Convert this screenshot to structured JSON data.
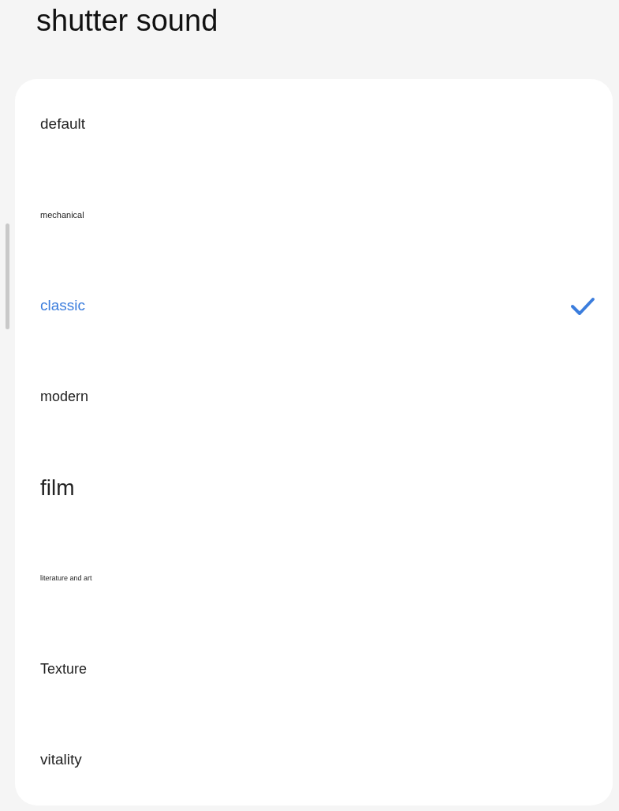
{
  "title": "shutter sound",
  "options": [
    {
      "label": "default",
      "selected": false
    },
    {
      "label": "mechanical",
      "selected": false
    },
    {
      "label": "classic",
      "selected": true
    },
    {
      "label": "modern",
      "selected": false
    },
    {
      "label": "film",
      "selected": false
    },
    {
      "label": "literature and art",
      "selected": false
    },
    {
      "label": "Texture",
      "selected": false
    },
    {
      "label": "vitality",
      "selected": false
    }
  ]
}
